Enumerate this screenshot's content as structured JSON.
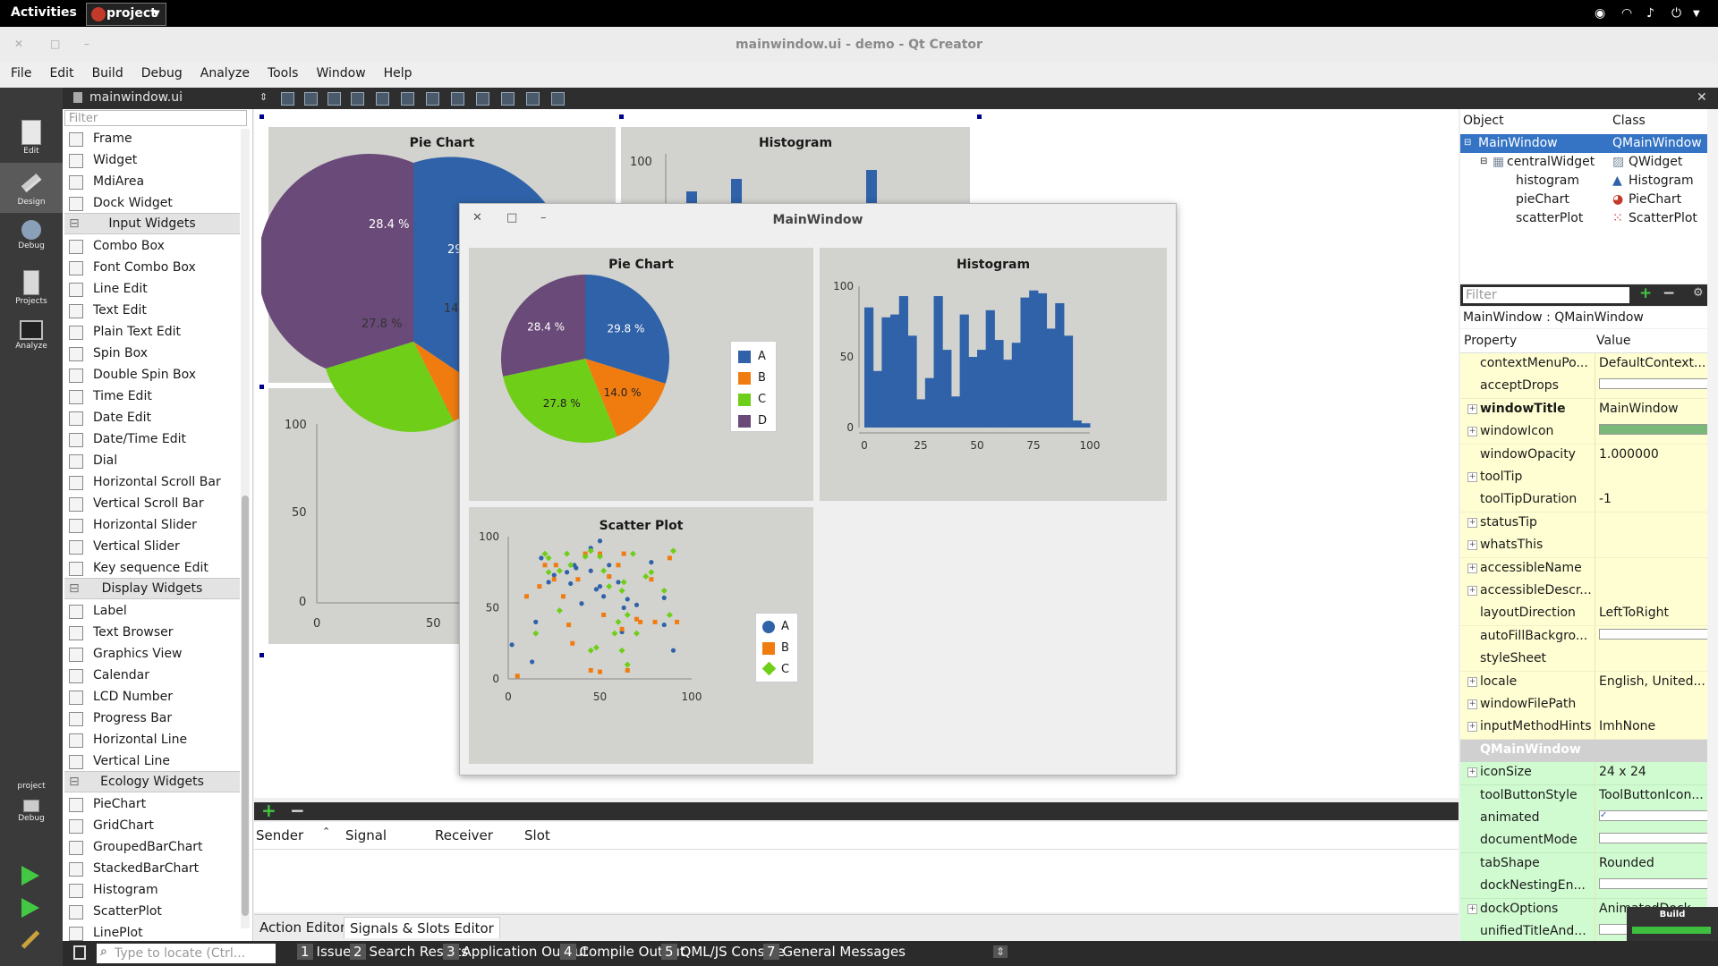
{
  "topbar": {
    "activities": "Activities",
    "app_name": "project"
  },
  "window": {
    "title": "mainwindow.ui - demo - Qt Creator"
  },
  "menu": [
    "File",
    "Edit",
    "Build",
    "Debug",
    "Analyze",
    "Tools",
    "Window",
    "Help"
  ],
  "modes": [
    {
      "label": "Edit",
      "icon": "edit-mode-icon"
    },
    {
      "label": "Design",
      "icon": "design-mode-icon"
    },
    {
      "label": "Debug",
      "icon": "debug-mode-icon"
    },
    {
      "label": "Projects",
      "icon": "projects-mode-icon"
    },
    {
      "label": "Analyze",
      "icon": "analyze-mode-icon"
    }
  ],
  "kit": {
    "project": "project",
    "config": "Debug"
  },
  "editor": {
    "file": "mainwindow.ui"
  },
  "widget_box": {
    "filter_placeholder": "Filter",
    "items": [
      {
        "type": "item",
        "label": "Frame"
      },
      {
        "type": "item",
        "label": "Widget"
      },
      {
        "type": "item",
        "label": "MdiArea"
      },
      {
        "type": "item",
        "label": "Dock Widget"
      },
      {
        "type": "cat",
        "label": "Input Widgets"
      },
      {
        "type": "item",
        "label": "Combo Box"
      },
      {
        "type": "item",
        "label": "Font Combo Box"
      },
      {
        "type": "item",
        "label": "Line Edit"
      },
      {
        "type": "item",
        "label": "Text Edit"
      },
      {
        "type": "item",
        "label": "Plain Text Edit"
      },
      {
        "type": "item",
        "label": "Spin Box"
      },
      {
        "type": "item",
        "label": "Double Spin Box"
      },
      {
        "type": "item",
        "label": "Time Edit"
      },
      {
        "type": "item",
        "label": "Date Edit"
      },
      {
        "type": "item",
        "label": "Date/Time Edit"
      },
      {
        "type": "item",
        "label": "Dial"
      },
      {
        "type": "item",
        "label": "Horizontal Scroll Bar"
      },
      {
        "type": "item",
        "label": "Vertical Scroll Bar"
      },
      {
        "type": "item",
        "label": "Horizontal Slider"
      },
      {
        "type": "item",
        "label": "Vertical Slider"
      },
      {
        "type": "item",
        "label": "Key sequence Edit"
      },
      {
        "type": "cat",
        "label": "Display Widgets"
      },
      {
        "type": "item",
        "label": "Label"
      },
      {
        "type": "item",
        "label": "Text Browser"
      },
      {
        "type": "item",
        "label": "Graphics View"
      },
      {
        "type": "item",
        "label": "Calendar"
      },
      {
        "type": "item",
        "label": "LCD Number"
      },
      {
        "type": "item",
        "label": "Progress Bar"
      },
      {
        "type": "item",
        "label": "Horizontal Line"
      },
      {
        "type": "item",
        "label": "Vertical Line"
      },
      {
        "type": "cat",
        "label": "Ecology Widgets"
      },
      {
        "type": "item",
        "label": "PieChart"
      },
      {
        "type": "item",
        "label": "GridChart"
      },
      {
        "type": "item",
        "label": "GroupedBarChart"
      },
      {
        "type": "item",
        "label": "StackedBarChart"
      },
      {
        "type": "item",
        "label": "Histogram"
      },
      {
        "type": "item",
        "label": "ScatterPlot"
      },
      {
        "type": "item",
        "label": "LinePlot"
      }
    ]
  },
  "preview": {
    "title": "MainWindow"
  },
  "design_form": {
    "pie_title": "Pie Chart",
    "hist_title": "Histogram",
    "scatter_title": "Scatter Plot",
    "pie_labels": [
      "28.4 %",
      "27.8 %",
      "29.8 %",
      "14.0 %"
    ]
  },
  "chart_data": [
    {
      "type": "pie",
      "title": "Pie Chart",
      "slices": [
        {
          "name": "A",
          "value": 29.8,
          "color": "#2f62a8"
        },
        {
          "name": "B",
          "value": 14.0,
          "color": "#f07c10"
        },
        {
          "name": "C",
          "value": 27.8,
          "color": "#6fce18"
        },
        {
          "name": "D",
          "value": 28.4,
          "color": "#6a4a78"
        }
      ],
      "slice_labels": [
        "29.8 %",
        "14.0 %",
        "27.8 %",
        "28.4 %"
      ],
      "legend": [
        "A",
        "B",
        "C",
        "D"
      ],
      "legend_position": "right"
    },
    {
      "type": "bar",
      "title": "Histogram",
      "color": "#2f62a8",
      "x_ticks": [
        "0",
        "25",
        "50",
        "75",
        "100"
      ],
      "y_ticks": [
        "0",
        "50",
        "100"
      ],
      "xlim": [
        0,
        100
      ],
      "ylim": [
        0,
        100
      ],
      "values": [
        85,
        40,
        78,
        80,
        93,
        65,
        20,
        35,
        93,
        55,
        22,
        80,
        50,
        55,
        83,
        62,
        48,
        60,
        92,
        97,
        95,
        70,
        88,
        65,
        5,
        3
      ]
    },
    {
      "type": "scatter",
      "title": "Scatter Plot",
      "x_ticks": [
        "0",
        "50",
        "100"
      ],
      "y_ticks": [
        "0",
        "50",
        "100"
      ],
      "xlim": [
        0,
        100
      ],
      "ylim": [
        0,
        100
      ],
      "legend": [
        "A",
        "B",
        "C"
      ],
      "legend_position": "right",
      "series": [
        {
          "name": "A",
          "color": "#2f62a8",
          "shape": "circle",
          "points": [
            [
              2,
              24
            ],
            [
              13,
              12
            ],
            [
              15,
              40
            ],
            [
              18,
              85
            ],
            [
              22,
              68
            ],
            [
              25,
              73
            ],
            [
              32,
              75
            ],
            [
              34,
              67
            ],
            [
              36,
              80
            ],
            [
              37,
              78
            ],
            [
              40,
              53
            ],
            [
              45,
              76
            ],
            [
              45,
              92
            ],
            [
              48,
              63
            ],
            [
              50,
              97
            ],
            [
              50,
              65
            ],
            [
              52,
              58
            ],
            [
              55,
              72
            ],
            [
              55,
              80
            ],
            [
              60,
              68
            ],
            [
              62,
              33
            ],
            [
              63,
              50
            ],
            [
              65,
              56
            ],
            [
              70,
              52
            ],
            [
              78,
              82
            ],
            [
              85,
              38
            ],
            [
              85,
              57
            ],
            [
              90,
              20
            ]
          ]
        },
        {
          "name": "B",
          "color": "#f07c10",
          "shape": "square",
          "points": [
            [
              5,
              2
            ],
            [
              10,
              58
            ],
            [
              17,
              65
            ],
            [
              20,
              80
            ],
            [
              25,
              70
            ],
            [
              26,
              80
            ],
            [
              30,
              58
            ],
            [
              33,
              38
            ],
            [
              35,
              25
            ],
            [
              38,
              70
            ],
            [
              42,
              88
            ],
            [
              45,
              6
            ],
            [
              50,
              5
            ],
            [
              50,
              88
            ],
            [
              52,
              45
            ],
            [
              55,
              72
            ],
            [
              60,
              80
            ],
            [
              62,
              35
            ],
            [
              63,
              88
            ],
            [
              65,
              6
            ],
            [
              70,
              42
            ],
            [
              72,
              40
            ],
            [
              78,
              70
            ],
            [
              80,
              40
            ],
            [
              88,
              85
            ],
            [
              92,
              40
            ]
          ]
        },
        {
          "name": "C",
          "color": "#6fce18",
          "shape": "diamond",
          "points": [
            [
              15,
              32
            ],
            [
              20,
              88
            ],
            [
              22,
              85
            ],
            [
              22,
              75
            ],
            [
              28,
              48
            ],
            [
              28,
              76
            ],
            [
              32,
              88
            ],
            [
              34,
              80
            ],
            [
              42,
              86
            ],
            [
              45,
              90
            ],
            [
              45,
              20
            ],
            [
              48,
              22
            ],
            [
              50,
              86
            ],
            [
              52,
              76
            ],
            [
              55,
              65
            ],
            [
              58,
              32
            ],
            [
              60,
              40
            ],
            [
              62,
              62
            ],
            [
              62,
              20
            ],
            [
              63,
              68
            ],
            [
              65,
              10
            ],
            [
              65,
              45
            ],
            [
              68,
              88
            ],
            [
              70,
              32
            ],
            [
              75,
              72
            ],
            [
              78,
              75
            ],
            [
              85,
              62
            ],
            [
              88,
              45
            ],
            [
              90,
              90
            ]
          ]
        }
      ]
    }
  ],
  "signals_slots": {
    "headers": [
      "Sender",
      "Signal",
      "Receiver",
      "Slot"
    ],
    "tabs": [
      "Action Editor",
      "Signals & Slots Editor"
    ]
  },
  "object_inspector": {
    "headers": [
      "Object",
      "Class"
    ],
    "rows": [
      {
        "object": "MainWindow",
        "class": "QMainWindow",
        "selected": true
      },
      {
        "object": "centralWidget",
        "class": "QWidget"
      },
      {
        "object": "histogram",
        "class": "Histogram"
      },
      {
        "object": "pieChart",
        "class": "PieChart"
      },
      {
        "object": "scatterPlot",
        "class": "ScatterPlot"
      }
    ]
  },
  "property_editor": {
    "filter_placeholder": "Filter",
    "class_label": "MainWindow : QMainWindow",
    "headers": [
      "Property",
      "Value"
    ],
    "rows": [
      {
        "name": "contextMenuPo...",
        "value": "DefaultContext...",
        "bg": "y"
      },
      {
        "name": "acceptDrops",
        "value": "",
        "bg": "y",
        "check": false
      },
      {
        "name": "windowTitle",
        "value": "MainWindow",
        "bg": "y",
        "expand": true,
        "bold": true
      },
      {
        "name": "windowIcon",
        "value": "",
        "bg": "y",
        "expand": true,
        "icon": true
      },
      {
        "name": "windowOpacity",
        "value": "1.000000",
        "bg": "y"
      },
      {
        "name": "toolTip",
        "value": "",
        "bg": "y",
        "expand": true
      },
      {
        "name": "toolTipDuration",
        "value": "-1",
        "bg": "y"
      },
      {
        "name": "statusTip",
        "value": "",
        "bg": "y",
        "expand": true
      },
      {
        "name": "whatsThis",
        "value": "",
        "bg": "y",
        "expand": true
      },
      {
        "name": "accessibleName",
        "value": "",
        "bg": "y",
        "expand": true
      },
      {
        "name": "accessibleDescr...",
        "value": "",
        "bg": "y",
        "expand": true
      },
      {
        "name": "layoutDirection",
        "value": "LeftToRight",
        "bg": "y"
      },
      {
        "name": "autoFillBackgro...",
        "value": "",
        "bg": "y",
        "check": false
      },
      {
        "name": "styleSheet",
        "value": "",
        "bg": "y"
      },
      {
        "name": "locale",
        "value": "English, United...",
        "bg": "y",
        "expand": true
      },
      {
        "name": "windowFilePath",
        "value": "",
        "bg": "y",
        "expand": true
      },
      {
        "name": "inputMethodHints",
        "value": "ImhNone",
        "bg": "y",
        "expand": true
      },
      {
        "name": "QMainWindow",
        "value": "",
        "bg": "hd",
        "header": true
      },
      {
        "name": "iconSize",
        "value": "24 x 24",
        "bg": "g",
        "expand": true
      },
      {
        "name": "toolButtonStyle",
        "value": "ToolButtonIcon...",
        "bg": "g"
      },
      {
        "name": "animated",
        "value": "",
        "bg": "g",
        "check": true
      },
      {
        "name": "documentMode",
        "value": "",
        "bg": "g",
        "check": false
      },
      {
        "name": "tabShape",
        "value": "Rounded",
        "bg": "g"
      },
      {
        "name": "dockNestingEn...",
        "value": "",
        "bg": "g",
        "check": false
      },
      {
        "name": "dockOptions",
        "value": "AnimatedDock...",
        "bg": "g",
        "expand": true
      },
      {
        "name": "unifiedTitleAnd...",
        "value": "",
        "bg": "g",
        "check": false
      }
    ]
  },
  "status_bar": {
    "locate_placeholder": "Type to locate (Ctrl...",
    "panes": [
      {
        "num": "1",
        "label": "Issues"
      },
      {
        "num": "2",
        "label": "Search Results"
      },
      {
        "num": "3",
        "label": "Application Output"
      },
      {
        "num": "4",
        "label": "Compile Output"
      },
      {
        "num": "5",
        "label": "QML/JS Console"
      },
      {
        "num": "7",
        "label": "General Messages"
      }
    ],
    "build_label": "Build"
  }
}
